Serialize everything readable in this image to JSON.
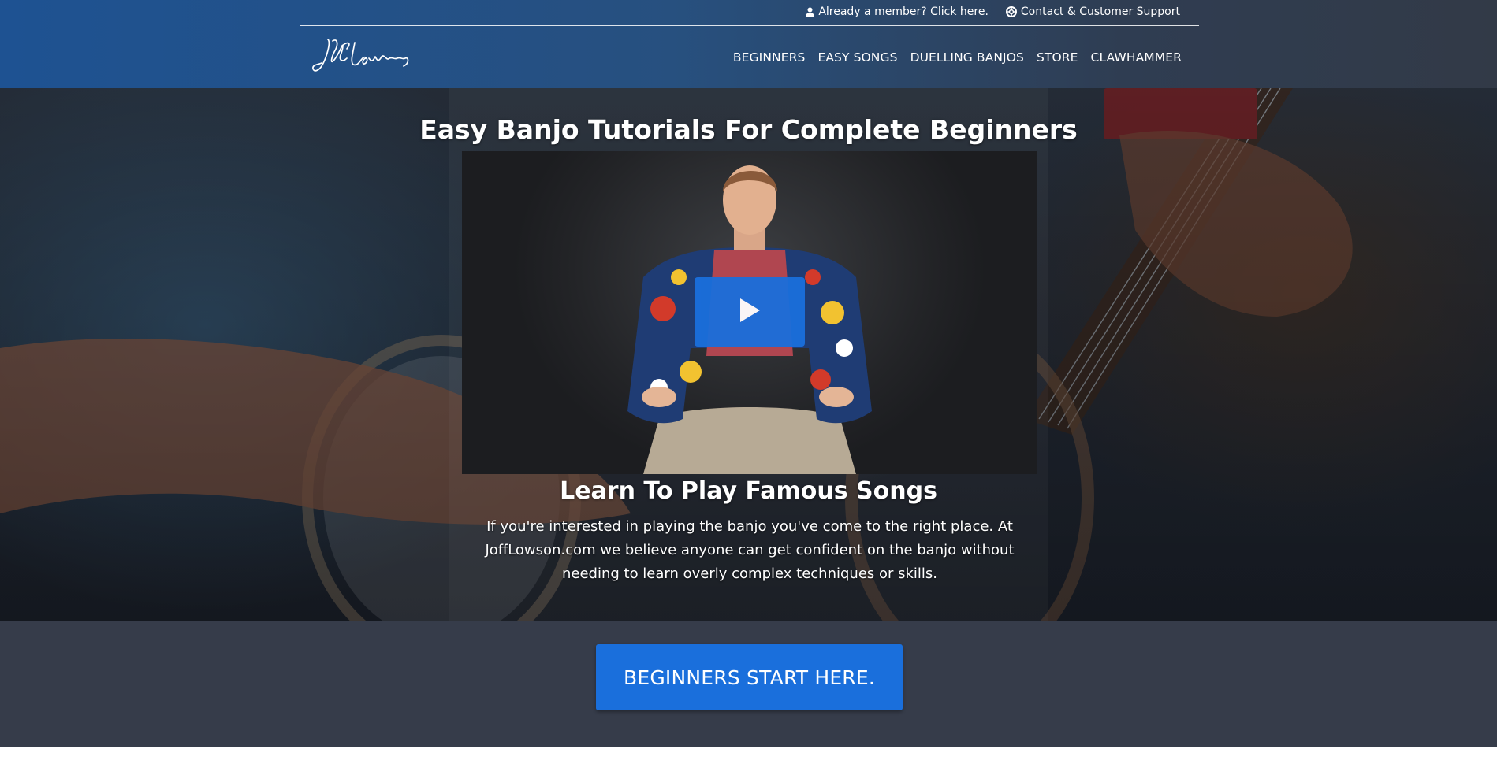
{
  "topbar": {
    "member_link": "Already a member? Click here.",
    "support_link": "Contact & Customer Support"
  },
  "logo": {
    "text": "JoffLowson"
  },
  "nav": {
    "items": [
      "BEGINNERS",
      "EASY SONGS",
      "DUELLING BANJOS",
      "STORE",
      "CLAWHAMMER"
    ]
  },
  "hero": {
    "title": "Easy Banjo Tutorials For Complete Beginners",
    "subtitle": "Learn To Play Famous Songs",
    "description": "If you're interested in playing the banjo you've come to the right place. At JoffLowson.com we believe anyone can get confident on the banjo without needing to learn overly complex techniques or skills."
  },
  "cta": {
    "label": "BEGINNERS START HERE."
  },
  "colors": {
    "accent": "#1a6fdc",
    "header_start": "#1e5292",
    "header_end": "#323a47",
    "cta_strip": "#363c4a"
  },
  "icons": {
    "member": "user-icon",
    "support": "lifebuoy-icon",
    "video": "play-icon"
  }
}
